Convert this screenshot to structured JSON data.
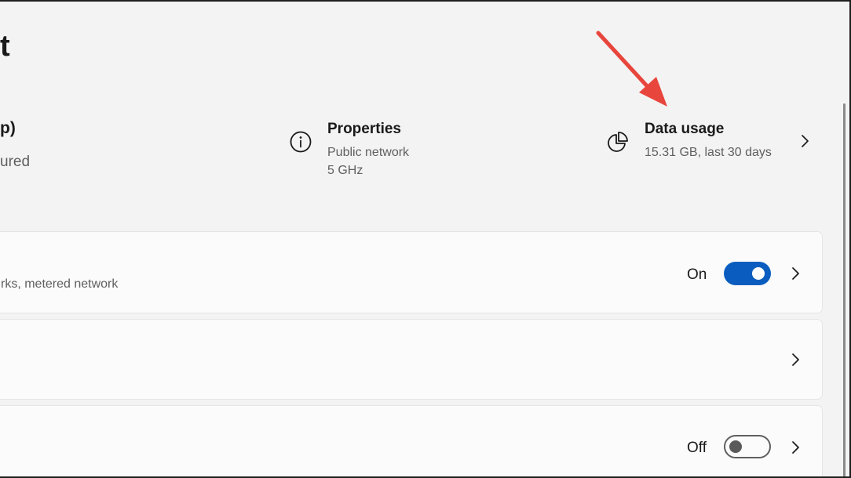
{
  "header": {
    "title_fragment": "t"
  },
  "network": {
    "name_fragment": "p)",
    "status_fragment": "ured"
  },
  "properties": {
    "icon": "info-icon",
    "title": "Properties",
    "lines": [
      "Public network",
      "5 GHz"
    ]
  },
  "data_usage": {
    "icon": "pie-chart-icon",
    "title": "Data usage",
    "detail": "15.31 GB, last 30 days"
  },
  "rows": [
    {
      "subtitle_fragment": "rks, metered network",
      "state_label": "On",
      "toggle_on": true
    },
    {
      "subtitle_fragment": "",
      "state_label": "",
      "toggle_on": null
    },
    {
      "subtitle_fragment": "",
      "state_label": "Off",
      "toggle_on": false
    }
  ],
  "colors": {
    "accent": "#0a5dbf",
    "annotation_arrow": "#e8453c",
    "background": "#f3f3f3",
    "card": "#fbfbfb"
  }
}
